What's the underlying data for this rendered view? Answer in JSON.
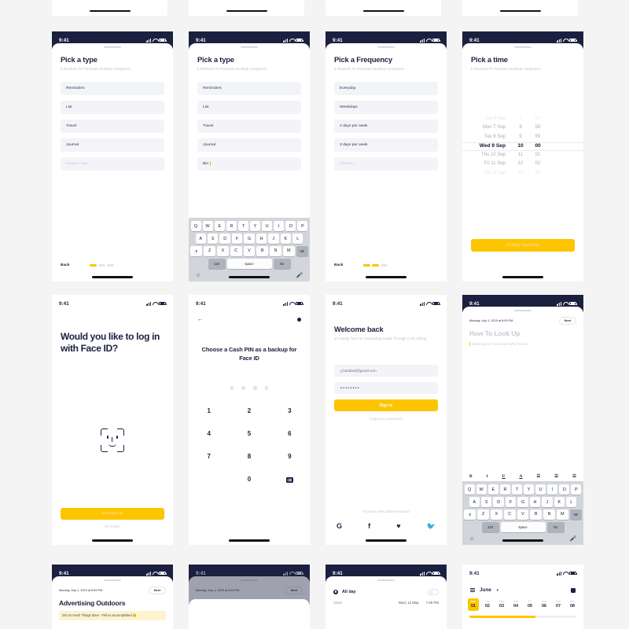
{
  "meta": {
    "status_time": "9:41"
  },
  "screens": {
    "pick_type": {
      "title": "Pick a type",
      "subtitle": "5 Reasons To Purchase Desktop Computers",
      "options": [
        "Reminders",
        "List",
        "Travel",
        "Journal"
      ],
      "custom_placeholder": "Custom Type",
      "back_label": "Back"
    },
    "pick_type_typing": {
      "title": "Pick a type",
      "subtitle": "5 Reasons To Purchase Desktop Computers",
      "options": [
        "Reminders",
        "List",
        "Travel",
        "Journal"
      ],
      "typed_value": "Bio"
    },
    "pick_frequency": {
      "title": "Pick a Frequency",
      "subtitle": "5 Reasons To Purchase Desktop Computers",
      "options": [
        "Everyday",
        "Weekdays",
        "2 days per week",
        "3 days per week"
      ],
      "custom_placeholder": "Custom ....",
      "back_label": "Back"
    },
    "pick_time": {
      "title": "Pick a time",
      "subtitle": "5 Reasons To Purchase Desktop Computers",
      "rows": [
        {
          "day": "Sun 6 Sep",
          "hour": "7",
          "minute": "57",
          "state": "far"
        },
        {
          "day": "Mon 7 Sep",
          "hour": "8",
          "minute": "58",
          "state": "near"
        },
        {
          "day": "Tue 8 Sep",
          "hour": "9",
          "minute": "59",
          "state": "near"
        },
        {
          "day": "Wed 9 Sep",
          "hour": "10",
          "minute": "00",
          "state": "selected"
        },
        {
          "day": "Thu 10 Sep",
          "hour": "11",
          "minute": "01",
          "state": "near"
        },
        {
          "day": "Fri 11 Sep",
          "hour": "12",
          "minute": "02",
          "state": "near"
        },
        {
          "day": "Sat 12 Sep",
          "hour": "13",
          "minute": "03",
          "state": "far"
        }
      ],
      "cta": "Adding Your Note"
    },
    "face_id": {
      "title": "Would you like to log in with Face ID?",
      "primary_button": "Use Face ID",
      "secondary_link": "No thanks"
    },
    "cash_pin": {
      "title": "Choose a Cash PIN as a backup for Face ID",
      "keys": [
        "1",
        "2",
        "3",
        "4",
        "5",
        "6",
        "7",
        "8",
        "9",
        "",
        "0",
        "delete"
      ],
      "pin_length": 4
    },
    "welcome_back": {
      "title": "Welcome back",
      "subtitle": "12 Handy Tips For Generating Leads Through Cold Calling",
      "email_value": "y.hasdisid@gmail.com",
      "password_value": "••••••••",
      "sign_in": "Sign in",
      "forgot": "Forgot your password?",
      "other_platform": "Try to use other platform account",
      "socials": [
        "G",
        "f",
        "♥",
        "ᵥ"
      ]
    },
    "note_editor": {
      "date": "Monday, July 1, 2019 at 5:09 PM",
      "next_label": "Next",
      "title": "How To Look Up",
      "body": "Branding Do You Know Who You Are",
      "format_tools": [
        "B",
        "I",
        "U",
        "A",
        "≡",
        "≡",
        "≡"
      ]
    },
    "article": {
      "date": "Monday, July 1, 2019 at 5:09 PM",
      "next_label": "Next",
      "title": "Advertising Outdoors",
      "highlight": "Got so much Things done - Fell so accomplished 😊"
    },
    "event": {
      "all_day_label": "All day",
      "all_day_on": false,
      "starts_label": "Starts",
      "starts_date": "Wed, 12 May",
      "starts_time": "7:30 PM"
    },
    "calendar": {
      "month": "June",
      "days": [
        {
          "dow": "Mon",
          "num": "01",
          "active": true
        },
        {
          "dow": "Tue",
          "num": "02",
          "active": false
        },
        {
          "dow": "Wed",
          "num": "03",
          "active": false
        },
        {
          "dow": "Thu",
          "num": "04",
          "active": false
        },
        {
          "dow": "Fri",
          "num": "05",
          "active": false
        },
        {
          "dow": "Sat",
          "num": "06",
          "active": false
        },
        {
          "dow": "Sun",
          "num": "07",
          "active": false
        },
        {
          "dow": "Mon",
          "num": "08",
          "active": false
        }
      ]
    }
  },
  "keyboard": {
    "row1": [
      "Q",
      "W",
      "E",
      "R",
      "T",
      "Y",
      "U",
      "I",
      "O",
      "P"
    ],
    "row2": [
      "A",
      "S",
      "D",
      "F",
      "G",
      "H",
      "J",
      "K",
      "L"
    ],
    "row3": [
      "⬆",
      "Z",
      "X",
      "C",
      "V",
      "B",
      "N",
      "M",
      "⌫"
    ],
    "numbers_key": "123",
    "space_key": "space",
    "go_key": "Go",
    "emoji_key": "☺",
    "mic_key": "Ἲ4"
  },
  "colors": {
    "accent": "#fdc500",
    "dark": "#1c2040",
    "page_bg": "#f4f4f4",
    "field_bg": "#f3f4f7"
  }
}
